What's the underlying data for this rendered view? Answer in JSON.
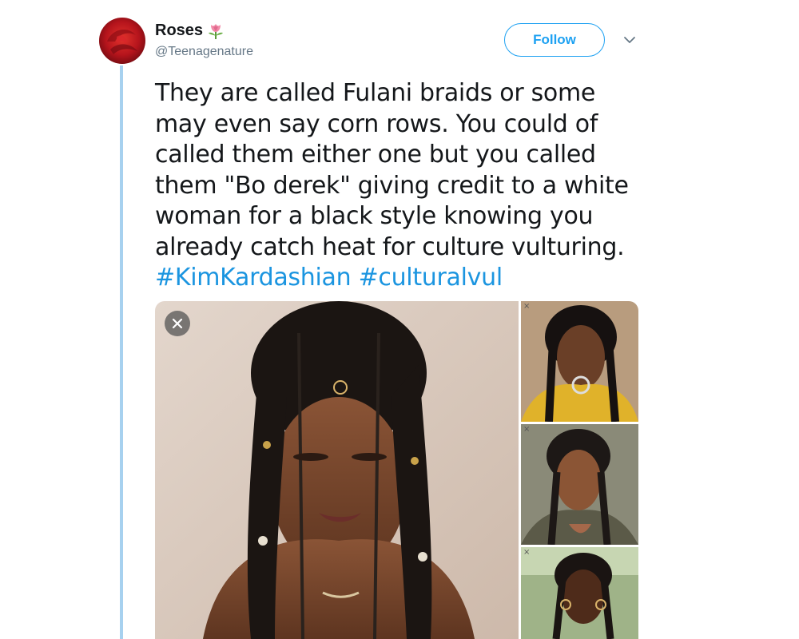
{
  "tweet": {
    "author": {
      "display_name": "Roses",
      "name_emoji": "rose-icon",
      "handle": "@Teenagenature",
      "avatar": "avatar"
    },
    "follow_label": "Follow",
    "more_icon": "chevron-down-icon",
    "text_lines": [
      "They are called Fulani braids or some",
      "may even say corn rows. You could of",
      "called them either one but you called",
      "them \"Bo derek\" giving credit to a white",
      "woman for a black style knowing you",
      "already catch heat for culture vulturing."
    ],
    "hashtags": [
      "#KimKardashian",
      "#culturalvul"
    ],
    "media": {
      "count": 4,
      "close_icon": "close-icon",
      "mini_close_icons": [
        "×",
        "×",
        "×"
      ]
    }
  },
  "colors": {
    "accent": "#1da1f2",
    "hashtag": "#1b95e0",
    "thread_line": "#a7d1ef",
    "secondary_text": "#657786"
  }
}
